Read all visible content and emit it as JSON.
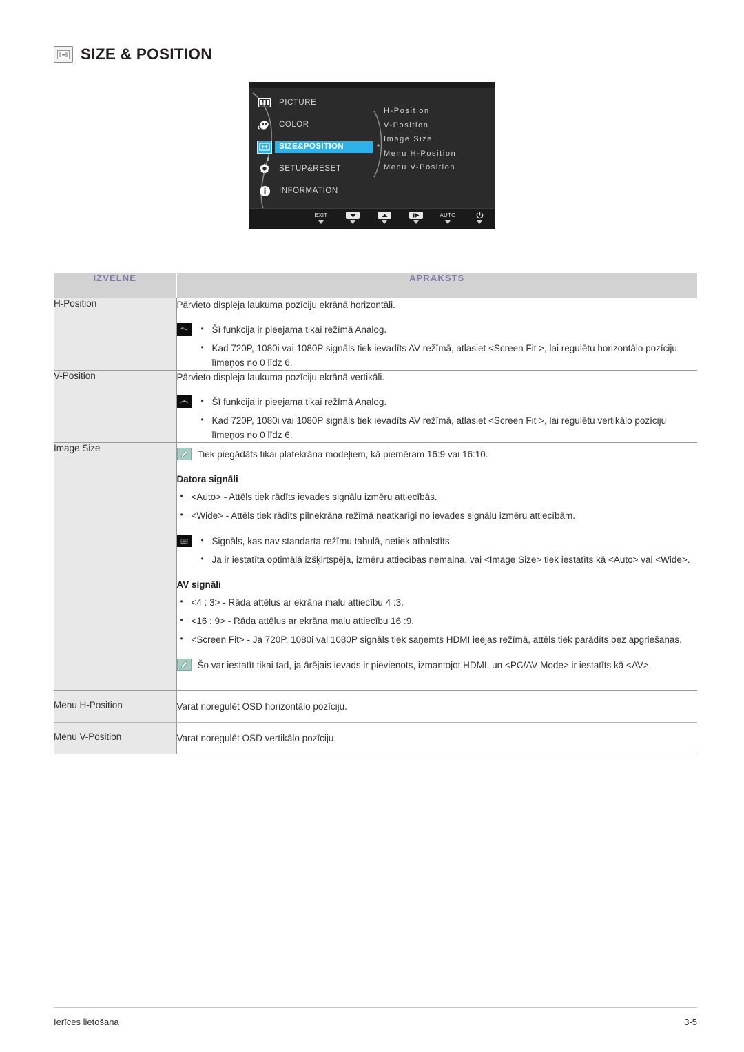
{
  "page": {
    "title": "SIZE & POSITION",
    "title_icon": "size-position-icon"
  },
  "osd": {
    "menu_items": [
      {
        "label": "PICTURE",
        "icon": "picture-icon",
        "selected": false
      },
      {
        "label": "COLOR",
        "icon": "color-icon",
        "selected": false
      },
      {
        "label": "SIZE&POSITION",
        "icon": "size-position-icon",
        "selected": true
      },
      {
        "label": "SETUP&RESET",
        "icon": "gear-icon",
        "selected": false
      },
      {
        "label": "INFORMATION",
        "icon": "info-icon",
        "selected": false
      }
    ],
    "submenu_items": [
      "H-Position",
      "V-Position",
      "Image Size",
      "Menu H-Position",
      "Menu V-Position"
    ],
    "buttons": [
      {
        "label": "EXIT",
        "icon": "exit-label",
        "boxed": false
      },
      {
        "label": "",
        "icon": "down-arrow-icon",
        "boxed": true
      },
      {
        "label": "",
        "icon": "up-arrow-icon",
        "boxed": true
      },
      {
        "label": "",
        "icon": "enter-icon",
        "boxed": true
      },
      {
        "label": "AUTO",
        "icon": "auto-label",
        "boxed": false
      },
      {
        "label": "",
        "icon": "power-icon",
        "boxed": false
      }
    ],
    "highlight_color": "#2bb3e8"
  },
  "table": {
    "headers": {
      "menu": "IZVĒLNE",
      "description": "APRAKSTS"
    },
    "header_text_color": "#7d7da6",
    "rows": [
      {
        "menu": "H-Position",
        "lead": "Pārvieto displeja laukuma pozīciju ekrānā horizontāli.",
        "note_icon": "caution-icon",
        "bullets": [
          "Šī funkcija ir pieejama tikai režīmā Analog.",
          "Kad 720P, 1080i vai 1080P signāls tiek ievadīts AV režīmā, atlasiet <Screen Fit  >, lai regulētu horizontālo pozīciju līmeņos no 0 līdz 6."
        ]
      },
      {
        "menu": "V-Position",
        "lead": "Pārvieto displeja laukuma pozīciju ekrānā vertikāli.",
        "note_icon": "caution-icon",
        "bullets": [
          "Šī funkcija ir pieejama tikai režīmā Analog.",
          "Kad 720P, 1080i vai 1080P signāls tiek ievadīts AV režīmā, atlasiet <Screen Fit  >, lai regulētu vertikālo pozīciju līmeņos no 0 līdz 6."
        ]
      },
      {
        "menu": "Image Size",
        "note_top_icon": "note-icon",
        "note_top": "Tiek piegādāts tikai platekrāna modeļiem, kā piemēram 16:9 vai 16:10.",
        "subhead_1": "Datora signāli",
        "bullets_1": [
          "<Auto> - Attēls tiek rādīts ievades signālu izmēru attiecībās.",
          "<Wide> - Attēls tiek rādīts pilnekrāna režīmā neatkarīgi no ievades signālu izmēru attiecībām."
        ],
        "note_icon_2": "caution-icon",
        "bullets_2": [
          "Signāls, kas nav standarta režīmu tabulā, netiek atbalstīts.",
          "Ja ir iestatīta optimālā izšķirtspēja, izmēru attiecības nemaina, vai <Image Size> tiek iestatīts kā <Auto> vai <Wide>."
        ],
        "subhead_2": "AV signāli",
        "bullets_3": [
          "<4 : 3> - Rāda attēlus ar ekrāna malu attiecību 4 :3.",
          "<16 : 9> - Rāda attēlus ar ekrāna malu attiecību 16 :9.",
          "<Screen Fit> - Ja 720P, 1080i vai 1080P signāls tiek saņemts HDMI ieejas režīmā, attēls tiek parādīts bez apgriešanas."
        ],
        "note_bottom_icon": "note-icon",
        "note_bottom": "Šo var iestatīt tikai tad, ja ārējais ievads ir pievienots, izmantojot HDMI, un <PC/AV Mode> ir iestatīts kā <AV>."
      },
      {
        "menu": "Menu H-Position",
        "lead": "Varat noregulēt OSD horizontālo pozīciju."
      },
      {
        "menu": "Menu V-Position",
        "lead": "Varat noregulēt OSD vertikālo pozīciju."
      }
    ]
  },
  "footer": {
    "left": "Ierīces lietošana",
    "right": "3-5"
  }
}
